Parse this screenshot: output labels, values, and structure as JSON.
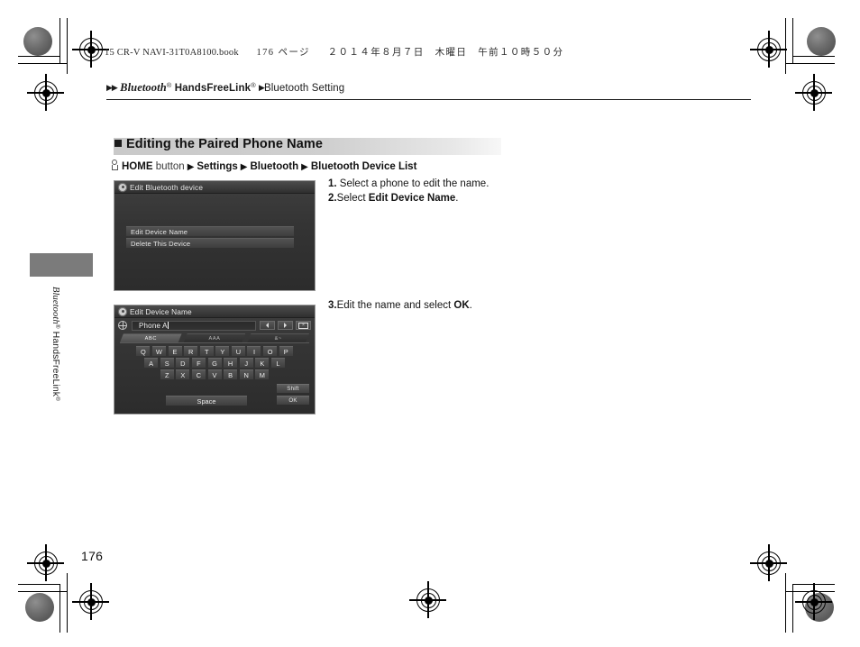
{
  "header": {
    "book_line_prefix": "15 CR-V NAVI-31T0A8100.book",
    "book_line_page": "176 ページ",
    "book_line_date": "２０１４年８月７日　木曜日　午前１０時５０分",
    "breadcrumb_bluetooth": "Bluetooth",
    "breadcrumb_hfl": "HandsFreeLink",
    "breadcrumb_tail": "Bluetooth Setting",
    "arrow_glyph": "▶▶",
    "arrow_single": "▶"
  },
  "section": {
    "title": "Editing the Paired Phone Name",
    "nav": {
      "home": "HOME",
      "button_word": "button",
      "settings": "Settings",
      "bluetooth": "Bluetooth",
      "device_list": "Bluetooth Device List",
      "separator": "▶"
    }
  },
  "steps": [
    {
      "num": "1.",
      "pre": "Select a phone to edit the name.",
      "bold": "",
      "post": ""
    },
    {
      "num": "2.",
      "pre": "Select ",
      "bold": "Edit Device Name",
      "post": "."
    },
    {
      "num": "3.",
      "pre": "Edit the name and select ",
      "bold": "OK",
      "post": "."
    }
  ],
  "screen_menu": {
    "title": "Edit Bluetooth device",
    "rows": [
      {
        "label": "Edit Device Name"
      },
      {
        "label": "Delete This Device"
      }
    ]
  },
  "screen_keyboard": {
    "title": "Edit Device Name",
    "input_value": "Phone A",
    "tabs": [
      {
        "label": "ABC",
        "active": true
      },
      {
        "label": "AAA",
        "active": false
      },
      {
        "label": "&~",
        "active": false
      }
    ],
    "controls": {
      "left_arrow": "◀",
      "right_arrow": "▶",
      "backspace": "⌫"
    },
    "rows": [
      [
        "Q",
        "W",
        "E",
        "R",
        "T",
        "Y",
        "U",
        "I",
        "O",
        "P"
      ],
      [
        "A",
        "S",
        "D",
        "F",
        "G",
        "H",
        "J",
        "K",
        "L"
      ],
      [
        "Z",
        "X",
        "C",
        "V",
        "B",
        "N",
        "M"
      ]
    ],
    "space_label": "Space",
    "shift_label": "Shift",
    "ok_label": "OK"
  },
  "side_tab": {
    "label_bluetooth": "Bluetooth",
    "label_rest": "HandsFreeLink"
  },
  "footer": {
    "page_number": "176"
  }
}
